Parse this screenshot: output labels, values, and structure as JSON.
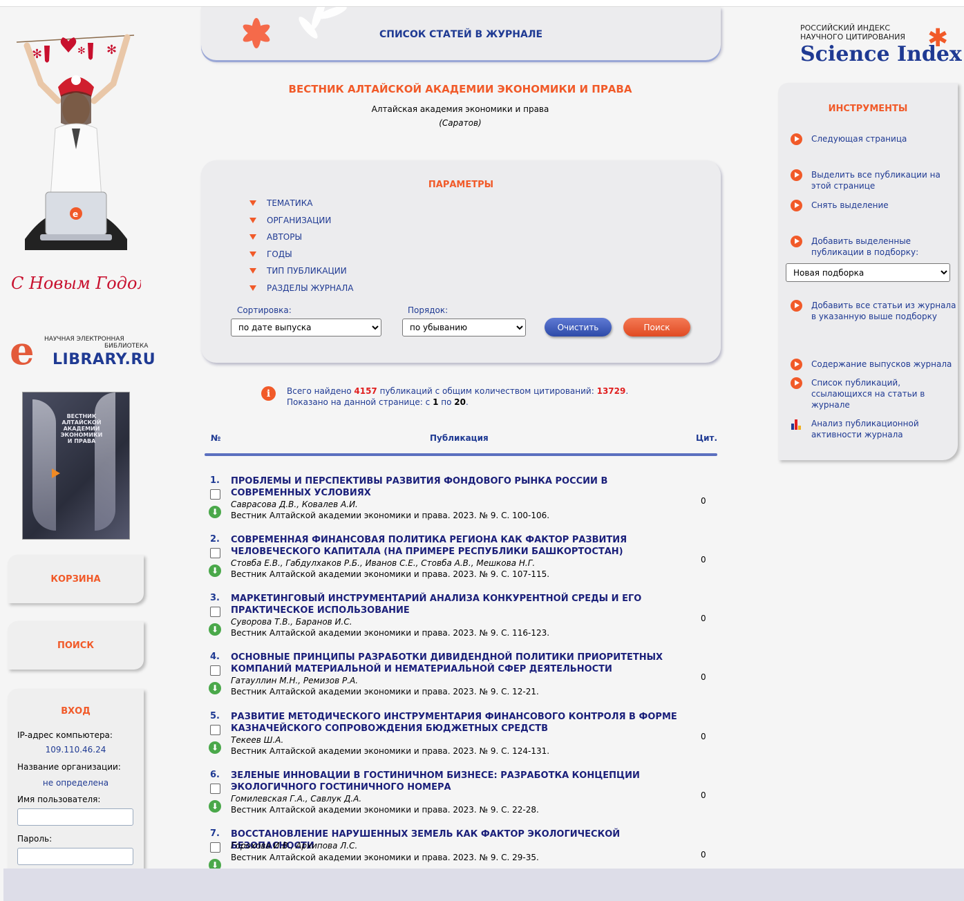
{
  "header": {
    "tab_title": "СПИСОК СТАТЕЙ В ЖУРНАЛЕ"
  },
  "branding": {
    "elib_line1": "НАУЧНАЯ ЭЛЕКТРОННАЯ",
    "elib_line2": "БИБЛИОТЕКА",
    "elib_name": "LIBRARY.RU",
    "promo_text": "С Новым Годом!",
    "cover_title": "ВЕСТНИК АЛТАЙСКОЙ АКАДЕМИИ ЭКОНОМИКИ И ПРАВА",
    "si_line1": "РОССИЙСКИЙ ИНДЕКС",
    "si_line2": "НАУЧНОГО ЦИТИРОВАНИЯ",
    "si_name": "Science Index"
  },
  "left": {
    "cart_label": "КОРЗИНА",
    "search_label": "ПОИСК",
    "login": {
      "title": "ВХОД",
      "ip_label": "IP-адрес компьютера:",
      "ip_value": "109.110.46.24",
      "org_label": "Название организации:",
      "org_value": "не определена",
      "user_label": "Имя пользователя:",
      "password_label": "Пароль:"
    }
  },
  "journal": {
    "title": "ВЕСТНИК АЛТАЙСКОЙ АКАДЕМИИ ЭКОНОМИКИ И ПРАВА",
    "org": "Алтайская академия экономики и права",
    "city": "(Саратов)"
  },
  "params": {
    "title": "ПАРАМЕТРЫ",
    "filters": [
      "ТЕМАТИКА",
      "ОРГАНИЗАЦИИ",
      "АВТОРЫ",
      "ГОДЫ",
      "ТИП ПУБЛИКАЦИИ",
      "РАЗДЕЛЫ ЖУРНАЛА"
    ],
    "sort_label": "Сортировка:",
    "sort_value": "по дате выпуска",
    "order_label": "Порядок:",
    "order_value": "по убыванию",
    "clear_label": "Очистить",
    "search_label": "Поиск"
  },
  "summary": {
    "found_prefix": "Всего найдено",
    "found_count": "4157",
    "found_middle": "публикаций с общим количеством цитирований:",
    "citations": "13729",
    "found_end": ".",
    "shown_prefix": "Показано на данной странице: с",
    "shown_from": "1",
    "shown_mid": "по",
    "shown_to": "20",
    "shown_end": "."
  },
  "table": {
    "col_num": "№",
    "col_pub": "Публикация",
    "col_cit": "Цит.",
    "rows": [
      {
        "num": "1.",
        "title": "ПРОБЛЕМЫ И ПЕРСПЕКТИВЫ РАЗВИТИЯ ФОНДОВОГО РЫНКА РОССИИ В СОВРЕМЕННЫХ УСЛОВИЯХ",
        "authors": "Саврасова Д.В., Ковалев А.И.",
        "source": "Вестник Алтайской академии экономики и права. 2023. № 9. С. 100-106.",
        "cit": "0"
      },
      {
        "num": "2.",
        "title": "СОВРЕМЕННАЯ ФИНАНСОВАЯ ПОЛИТИКА РЕГИОНА КАК ФАКТОР РАЗВИТИЯ ЧЕЛОВЕЧЕСКОГО КАПИТАЛА (НА ПРИМЕРЕ РЕСПУБЛИКИ БАШКОРТОСТАН)",
        "authors": "Стовба Е.В., Габдулхаков Р.Б., Иванов С.Е., Стовба А.В., Мешкова Н.Г.",
        "source": "Вестник Алтайской академии экономики и права. 2023. № 9. С. 107-115.",
        "cit": "0"
      },
      {
        "num": "3.",
        "title": "МАРКЕТИНГОВЫЙ ИНСТРУМЕНТАРИЙ АНАЛИЗА КОНКУРЕНТНОЙ СРЕДЫ И ЕГО ПРАКТИЧЕСКОЕ ИСПОЛЬЗОВАНИЕ",
        "authors": "Суворова Т.В., Баранов И.С.",
        "source": "Вестник Алтайской академии экономики и права. 2023. № 9. С. 116-123.",
        "cit": "0"
      },
      {
        "num": "4.",
        "title": "ОСНОВНЫЕ ПРИНЦИПЫ РАЗРАБОТКИ ДИВИДЕНДНОЙ ПОЛИТИКИ ПРИОРИТЕТНЫХ КОМПАНИЙ МАТЕРИАЛЬНОЙ И НЕМАТЕРИАЛЬНОЙ СФЕР ДЕЯТЕЛЬНОСТИ",
        "authors": "Гатауллин М.Н., Ремизов Р.А.",
        "source": "Вестник Алтайской академии экономики и права. 2023. № 9. С. 12-21.",
        "cit": "0"
      },
      {
        "num": "5.",
        "title": "РАЗВИТИЕ МЕТОДИЧЕСКОГО ИНСТРУМЕНТАРИЯ ФИНАНСОВОГО КОНТРОЛЯ В ФОРМЕ КАЗНАЧЕЙСКОГО СОПРОВОЖДЕНИЯ БЮДЖЕТНЫХ СРЕДСТВ",
        "authors": "Текеев Ш.А.",
        "source": "Вестник Алтайской академии экономики и права. 2023. № 9. С. 124-131.",
        "cit": "0"
      },
      {
        "num": "6.",
        "title": "ЗЕЛЕНЫЕ ИННОВАЦИИ В ГОСТИНИЧНОМ БИЗНЕСЕ: РАЗРАБОТКА КОНЦЕПЦИИ ЭКОЛОГИЧНОГО ГОСТИНИЧНОГО НОМЕРА",
        "authors": "Гомилевская Г.А., Савлук Д.А.",
        "source": "Вестник Алтайской академии экономики и права. 2023. № 9. С. 22-28.",
        "cit": "0"
      },
      {
        "num": "7.",
        "title": "ВОССТАНОВЛЕНИЕ НАРУШЕННЫХ ЗЕМЕЛЬ КАК ФАКТОР ЭКОЛОГИЧЕСКОЙ БЕЗОПАСНОСТИ",
        "authors": "Горохова И.В., Архипова Л.С.",
        "source": "Вестник Алтайской академии экономики и права. 2023. № 9. С. 29-35.",
        "cit": "0"
      }
    ]
  },
  "tools": {
    "title": "ИНСТРУМЕНТЫ",
    "next_page": "Следующая страница",
    "select_all": "Выделить все публикации на этой странице",
    "deselect": "Снять выделение",
    "add_selected": "Добавить выделенные публикации в подборку:",
    "collection_value": "Новая подборка",
    "add_all": "Добавить все статьи из журнала в указанную выше подборку",
    "contents": "Содержание выпусков журнала",
    "citing_list": "Список публикаций, ссылающихся на статьи в журнале",
    "analysis": "Анализ публикационной активности журнала"
  },
  "colors": {
    "accent": "#f15a29",
    "link": "#1f3a93",
    "title": "#1a1f7a",
    "panel": "#ececee"
  }
}
